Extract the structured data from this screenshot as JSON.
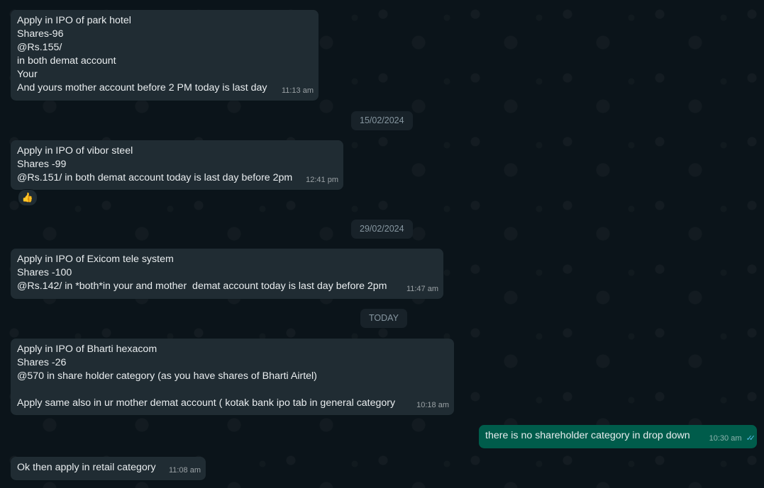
{
  "messages": [
    {
      "lines": [
        "Apply in IPO of park hotel",
        "Shares-96",
        "@Rs.155/",
        "in both demat account",
        "Your",
        "And yours mother account before 2 PM today is last day"
      ],
      "time": "11:13 am"
    },
    {
      "lines": [
        "Apply in IPO of vibor steel",
        "Shares -99",
        "@Rs.151/ in both demat account today is last day before 2pm"
      ],
      "time": "12:41 pm",
      "reaction": "👍"
    },
    {
      "lines": [
        "Apply in IPO of Exicom tele system",
        "Shares -100",
        "@Rs.142/ in *both*in your and mother  demat account today is last day before 2pm"
      ],
      "time": "11:47 am"
    },
    {
      "lines": [
        "Apply in IPO of Bharti hexacom",
        "Shares -26",
        "@570 in share holder category (as you have shares of Bharti Airtel)",
        "",
        "Apply same also in ur mother demat account ( kotak bank ipo tab in general category"
      ],
      "time": "10:18 am"
    },
    {
      "lines": [
        "there is no shareholder category in drop down"
      ],
      "time": "10:30 am",
      "ticks": "✓✓"
    },
    {
      "lines": [
        "Ok then apply in retail category"
      ],
      "time": "11:08 am"
    }
  ],
  "date_chips": [
    "15/02/2024",
    "29/02/2024",
    "TODAY"
  ]
}
